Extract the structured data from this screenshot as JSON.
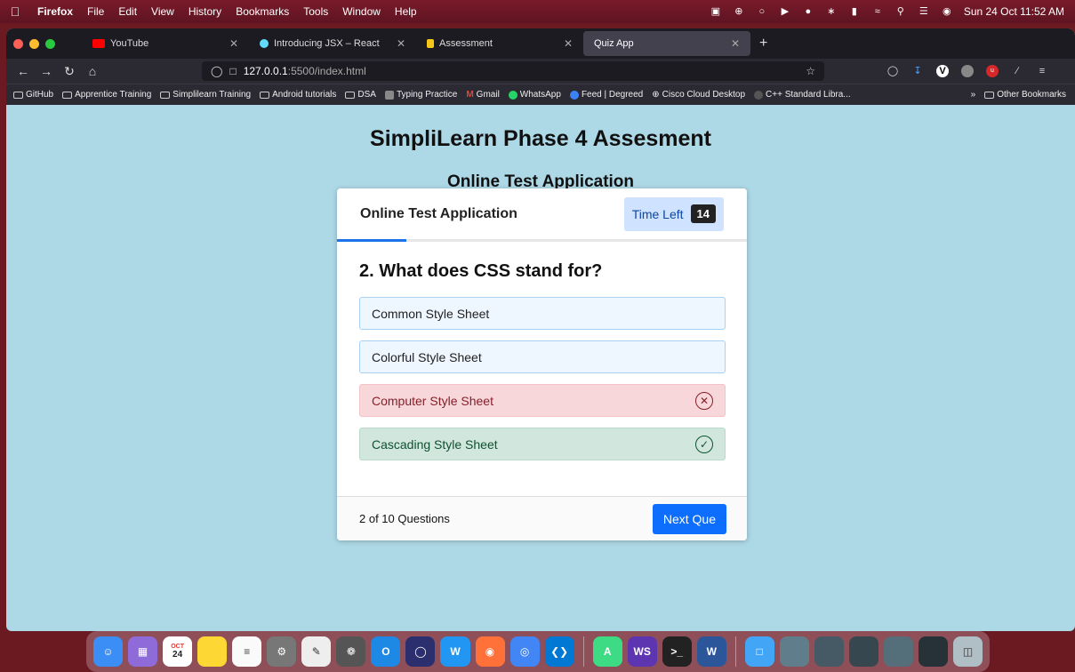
{
  "menubar": {
    "app": "Firefox",
    "items": [
      "File",
      "Edit",
      "View",
      "History",
      "Bookmarks",
      "Tools",
      "Window",
      "Help"
    ],
    "datetime": "Sun 24 Oct 11:52 AM"
  },
  "tabs": [
    {
      "label": "YouTube",
      "color": "#ff0000",
      "active": false
    },
    {
      "label": "Introducing JSX – React",
      "color": "#61dafb",
      "active": false
    },
    {
      "label": "Assessment",
      "color": "#f5c518",
      "active": false
    },
    {
      "label": "Quiz App",
      "color": "#42414d",
      "active": true
    }
  ],
  "url": {
    "host": "127.0.0.1",
    "path": ":5500/index.html"
  },
  "bookmarks": {
    "items": [
      "GitHub",
      "Apprentice Training",
      "Simplilearn Training",
      "Android tutorials",
      "DSA",
      "Typing Practice",
      "Gmail",
      "WhatsApp",
      "Feed | Degreed",
      "Cisco Cloud Desktop",
      "C++ Standard Libra..."
    ],
    "other": "Other Bookmarks"
  },
  "page": {
    "title": "SimpliLearn Phase 4 Assesment",
    "subtitle": "Online Test Application"
  },
  "quiz": {
    "header_title": "Online Test Application",
    "timer_label": "Time Left",
    "timer_value": "14",
    "question": "2. What does CSS stand for?",
    "options": [
      {
        "text": "Common Style Sheet",
        "state": "neutral"
      },
      {
        "text": "Colorful Style Sheet",
        "state": "neutral"
      },
      {
        "text": "Computer Style Sheet",
        "state": "wrong"
      },
      {
        "text": "Cascading Style Sheet",
        "state": "right"
      }
    ],
    "progress": "2 of 10 Questions",
    "next_label": "Next Que"
  },
  "dock": {
    "calendar_month": "OCT",
    "calendar_day": "24"
  }
}
